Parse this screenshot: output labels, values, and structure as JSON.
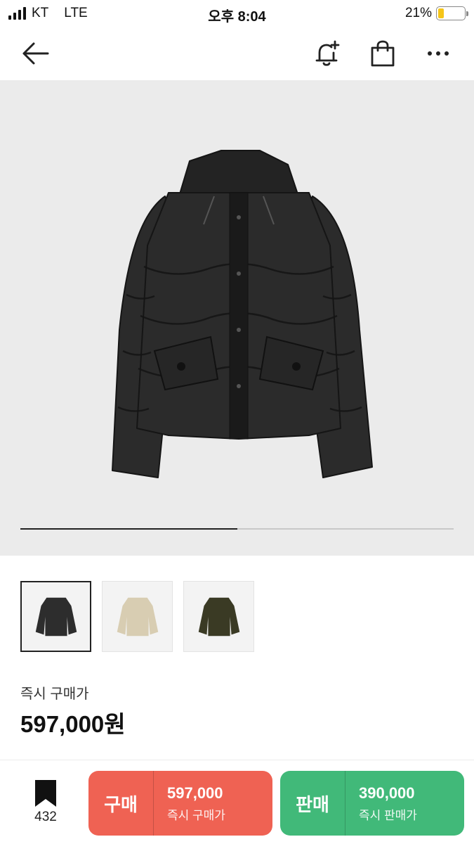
{
  "status_bar": {
    "carrier": "KT",
    "network": "LTE",
    "time": "오후 8:04",
    "battery_percent": "21%",
    "battery_level": 0.21
  },
  "nav": {
    "back_icon": "arrow-left-icon",
    "alert_icon": "bell-plus-icon",
    "bag_icon": "shopping-bag-icon",
    "more_icon": "more-horizontal-icon"
  },
  "gallery": {
    "progress": 0.5,
    "thumbnails": [
      {
        "color": "#2d2d2d",
        "active": true
      },
      {
        "color": "#d8cdb2",
        "active": false
      },
      {
        "color": "#3a3a24",
        "active": false
      }
    ]
  },
  "price": {
    "label": "즉시 구매가",
    "value": "597,000원"
  },
  "bottom": {
    "wish_icon": "bookmark-icon",
    "wish_count": "432",
    "buy": {
      "label": "구매",
      "price": "597,000",
      "sub": "즉시 구매가",
      "color": "#ef6253"
    },
    "sell": {
      "label": "판매",
      "price": "390,000",
      "sub": "즉시 판매가",
      "color": "#41b979"
    }
  }
}
